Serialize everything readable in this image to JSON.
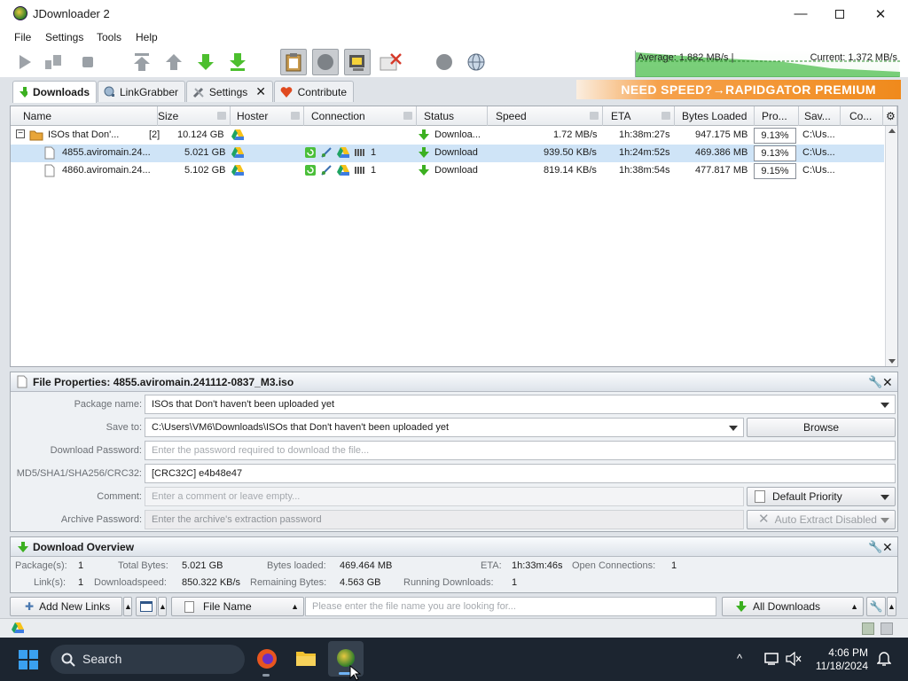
{
  "window": {
    "title": "JDownloader 2"
  },
  "menu": [
    "File",
    "Settings",
    "Tools",
    "Help"
  ],
  "speed": {
    "average": "Average: 1.882 MB/s |",
    "current": "Current: 1.372 MB/s"
  },
  "tabs": [
    {
      "label": "Downloads",
      "active": true
    },
    {
      "label": "LinkGrabber"
    },
    {
      "label": "Settings"
    },
    {
      "label": "Contribute"
    }
  ],
  "banner": "NEED SPEED?→RAPIDGATOR PREMIUM",
  "columns": [
    "Name",
    "Size",
    "Hoster",
    "Connection",
    "Status",
    "Speed",
    "ETA",
    "Bytes Loaded",
    "Pro...",
    "Sav...",
    "Co..."
  ],
  "package": {
    "expander": "−",
    "name": "ISOs that Don'...",
    "count": "[2]",
    "size": "10.124 GB",
    "status": "Downloa...",
    "speed": "1.72 MB/s",
    "eta": "1h:38m:27s",
    "loaded": "947.175 MB",
    "progress": "9.13%",
    "save": "C:\\Us..."
  },
  "files": [
    {
      "name": "4855.aviromain.24...",
      "size": "5.021 GB",
      "conn_count": "1",
      "status": "Download",
      "speed": "939.50 KB/s",
      "eta": "1h:24m:52s",
      "loaded": "469.386 MB",
      "progress": "9.13%",
      "save": "C:\\Us...",
      "selected": true
    },
    {
      "name": "4860.aviromain.24...",
      "size": "5.102 GB",
      "conn_count": "1",
      "status": "Download",
      "speed": "819.14 KB/s",
      "eta": "1h:38m:54s",
      "loaded": "477.817 MB",
      "progress": "9.15%",
      "save": "C:\\Us...",
      "selected": false
    }
  ],
  "properties": {
    "title": "File Properties: 4855.aviromain.241112-0837_M3.iso",
    "package_name_label": "Package name:",
    "package_name": "ISOs that Don't haven't been uploaded yet",
    "save_to_label": "Save to:",
    "save_to": "C:\\Users\\VM6\\Downloads\\ISOs that Don't haven't been uploaded yet",
    "browse": "Browse",
    "password_label": "Download Password:",
    "password_placeholder": "Enter the password required to download the file...",
    "hash_label": "MD5/SHA1/SHA256/CRC32:",
    "hash": "[CRC32C] e4b48e47",
    "comment_label": "Comment:",
    "comment_placeholder": "Enter a comment or leave empty...",
    "priority": "Default Priority",
    "archive_label": "Archive Password:",
    "archive_placeholder": "Enter the archive's extraction password",
    "auto_extract": "Auto Extract Disabled"
  },
  "overview": {
    "title": "Download Overview",
    "packages_label": "Package(s):",
    "packages": "1",
    "total_label": "Total Bytes:",
    "total": "5.021 GB",
    "loaded_label": "Bytes loaded:",
    "loaded": "469.464 MB",
    "eta_label": "ETA:",
    "eta": "1h:33m:46s",
    "conn_label": "Open Connections:",
    "conn": "1",
    "links_label": "Link(s):",
    "links": "1",
    "dlspeed_label": "Downloadspeed:",
    "dlspeed": "850.322 KB/s",
    "remaining_label": "Remaining Bytes:",
    "remaining": "4.563 GB",
    "running_label": "Running Downloads:",
    "running": "1"
  },
  "bottom": {
    "add_links": "Add New Links",
    "search_field": "File Name",
    "search_placeholder": "Please enter the file name you are looking for...",
    "filter": "All Downloads"
  },
  "taskbar": {
    "search": "Search",
    "time": "4:06 PM",
    "date": "11/18/2024"
  }
}
